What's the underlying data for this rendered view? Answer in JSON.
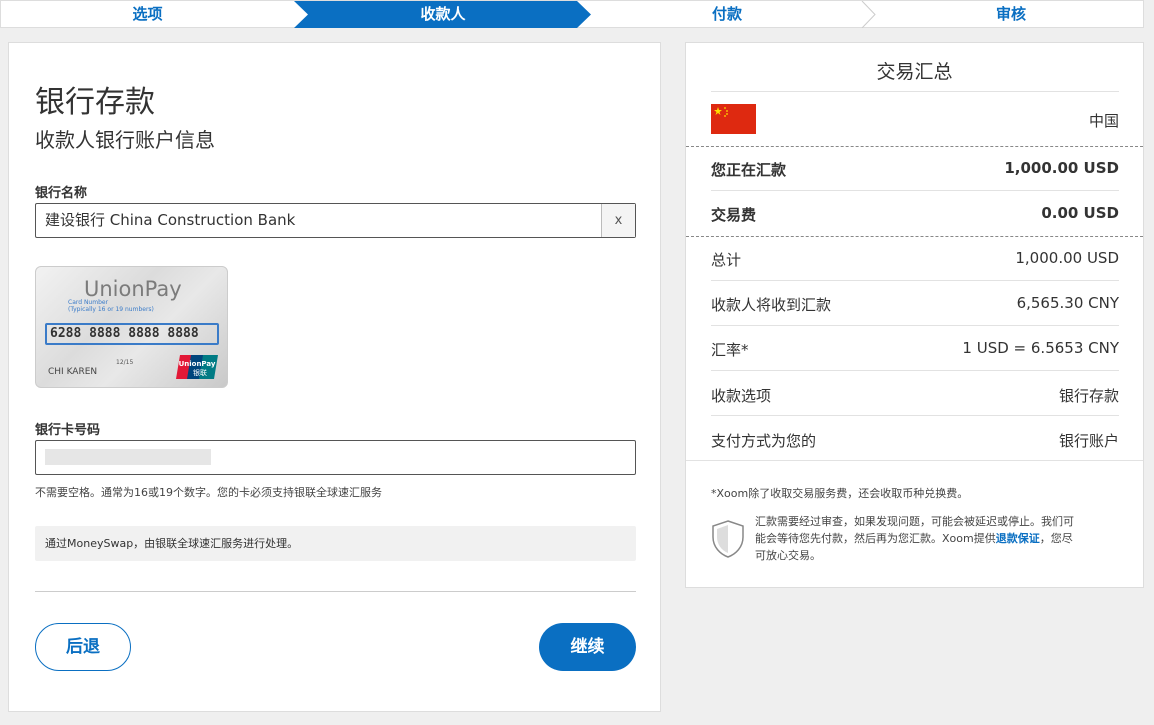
{
  "steps": [
    {
      "label": "选项"
    },
    {
      "label": "收款人"
    },
    {
      "label": "付款"
    },
    {
      "label": "审核"
    }
  ],
  "colors": {
    "brand": "#0a6fc2",
    "active_step_text": "#ffffff",
    "flag_red": "#de2910"
  },
  "form": {
    "title": "银行存款",
    "subtitle": "收款人银行账户信息",
    "bank_label": "银行名称",
    "bank_value": "建设银行 China Construction Bank",
    "clear_glyph": "x",
    "card": {
      "brand": "UnionPay",
      "hint_line1": "Card Number",
      "hint_line2": "(Typically 16 or 19 numbers)",
      "number": "6288 8888 8888 8888",
      "valid": "12/15",
      "name": "CHI  KAREN",
      "logo_top": "UnionPay",
      "logo_bottom": "银联"
    },
    "card_number_label": "银行卡号码",
    "card_number_value": "",
    "hint": "不需要空格。通常为16或19个数字。您的卡必须支持银联全球速汇服务",
    "info": "通过MoneySwap，由银联全球速汇服务进行处理。",
    "back_label": "后退",
    "continue_label": "继续"
  },
  "summary": {
    "title": "交易汇总",
    "country": "中国",
    "rows_top": [
      {
        "key": "您正在汇款",
        "value": "1,000.00 USD"
      },
      {
        "key": "交易费",
        "value": "0.00 USD"
      }
    ],
    "rows": [
      {
        "key": "总计",
        "value": "1,000.00 USD"
      },
      {
        "key": "收款人将收到汇款",
        "value": "6,565.30 CNY"
      },
      {
        "key": "汇率*",
        "value": "1 USD = 6.5653 CNY"
      },
      {
        "key": "收款选项",
        "value": "银行存款"
      },
      {
        "key": "支付方式为您的",
        "value": "银行账户"
      }
    ],
    "footnote": "*Xoom除了收取交易服务费，还会收取币种兑换费。",
    "guarantee_text": "汇款需要经过审查，如果发现问题，可能会被延迟或停止。我们可能会等待您先付款，然后再为您汇款。Xoom提供",
    "guarantee_link": "退款保证",
    "guarantee_tail": "，您尽可放心交易。"
  }
}
